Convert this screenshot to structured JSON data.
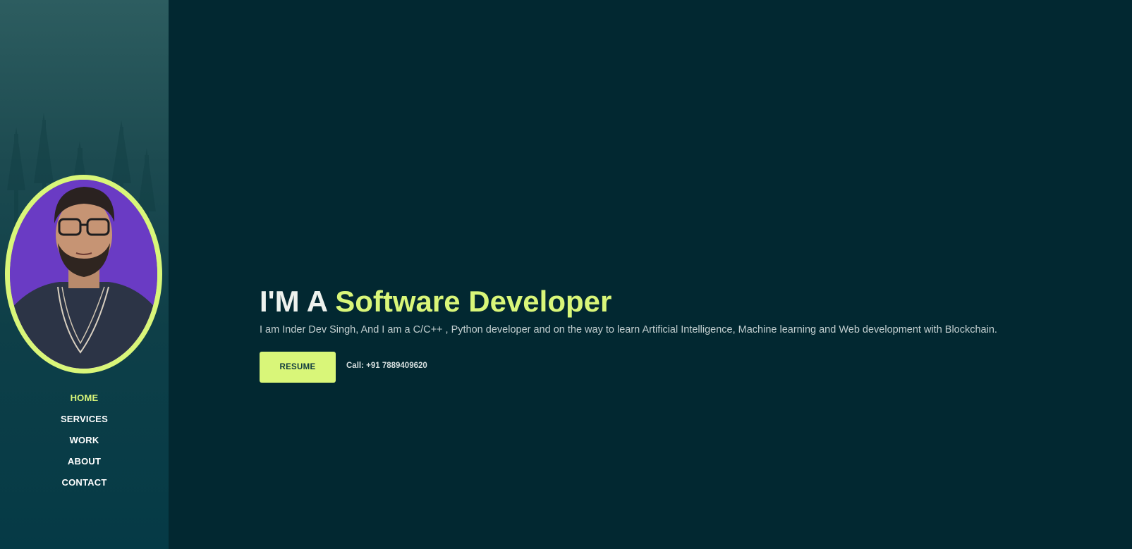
{
  "sidebar": {
    "avatar_alt": "Inder Dev Singh",
    "nav": [
      {
        "label": "HOME",
        "active": true
      },
      {
        "label": "SERVICES",
        "active": false
      },
      {
        "label": "WORK",
        "active": false
      },
      {
        "label": "ABOUT",
        "active": false
      },
      {
        "label": "CONTACT",
        "active": false
      }
    ]
  },
  "hero": {
    "title_prefix": "I'M A ",
    "title_accent": "Software Developer",
    "description": "I am Inder Dev Singh, And I am a C/C++ , Python developer and on the way to learn Artificial Intelligence, Machine learning and Web development with Blockchain.",
    "resume_label": "RESUME",
    "call_text": "Call: +91 7889409620"
  },
  "colors": {
    "accent": "#d9f679",
    "background": "#022831",
    "avatar_bg": "#6a3bc4"
  }
}
